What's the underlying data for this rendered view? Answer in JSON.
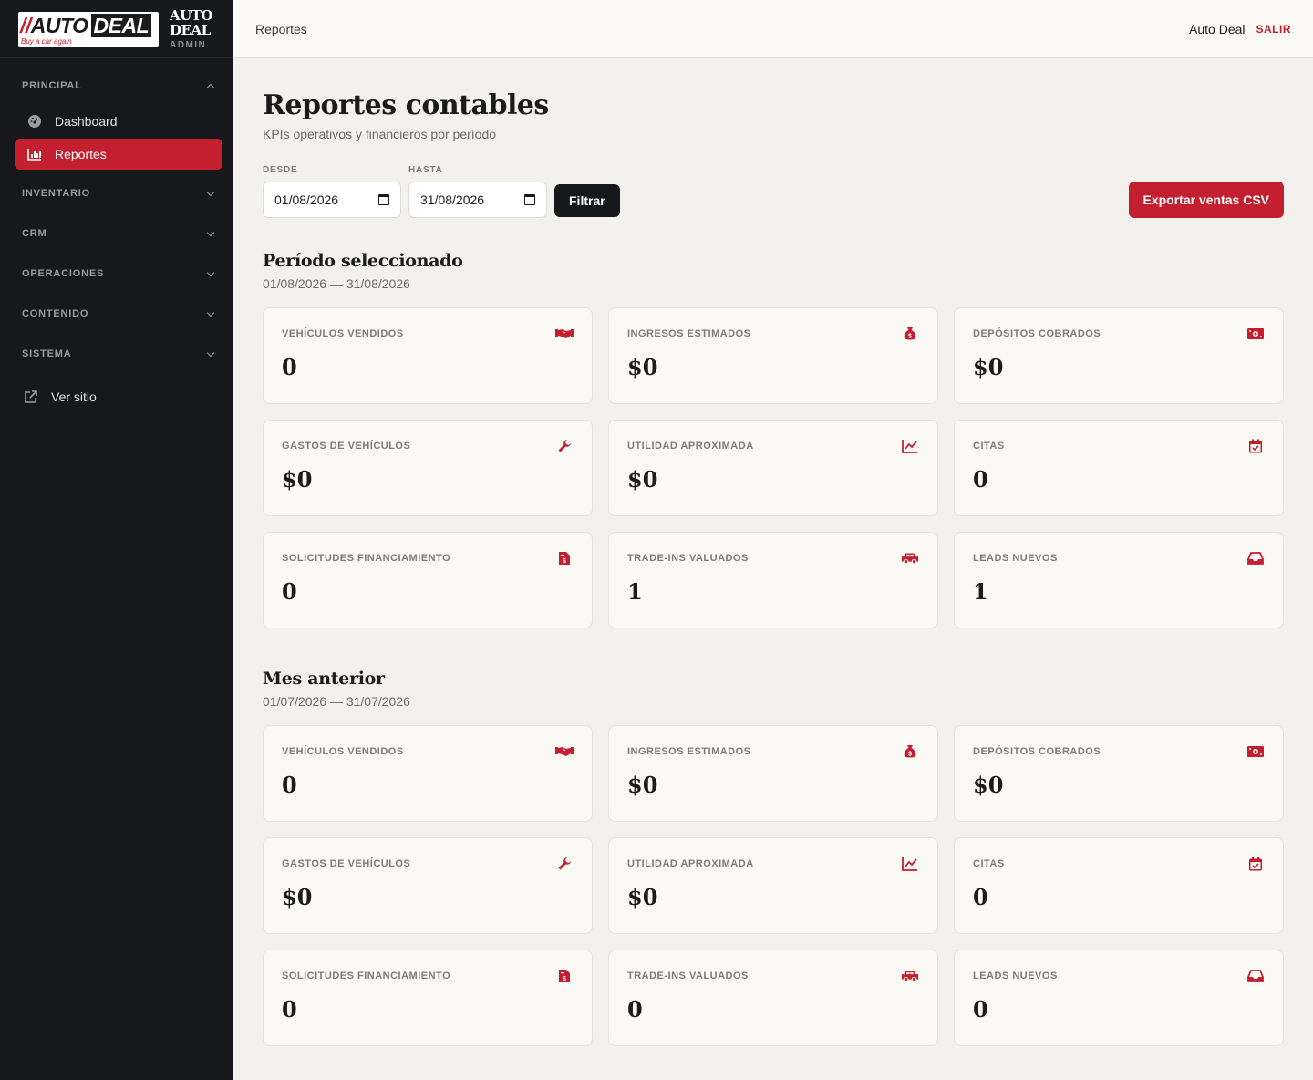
{
  "brand": {
    "logo_slash": "//",
    "logo_auto": "AUTO",
    "logo_deal": "DEAL",
    "logo_tagline": "Buy a car again",
    "name_line1": "AUTO",
    "name_line2": "DEAL",
    "subtitle": "ADMIN"
  },
  "sidebar": {
    "principal": "PRINCIPAL",
    "dashboard": "Dashboard",
    "reportes": "Reportes",
    "inventario": "INVENTARIO",
    "crm": "CRM",
    "operaciones": "OPERACIONES",
    "contenido": "CONTENIDO",
    "sistema": "SISTEMA",
    "ver_sitio": "Ver sitio"
  },
  "topbar": {
    "breadcrumb": "Reportes",
    "user": "Auto Deal",
    "logout": "SALIR"
  },
  "page": {
    "title": "Reportes contables",
    "subtitle": "KPIs operativos y financieros por período"
  },
  "filters": {
    "from_label": "DESDE",
    "from_value": "01/08/2026",
    "to_label": "HASTA",
    "to_value": "31/08/2026",
    "filter_button": "Filtrar",
    "export_button": "Exportar ventas CSV"
  },
  "accent_color": "#c41f2e",
  "sections": [
    {
      "title": "Período seleccionado",
      "range": "01/08/2026 — 31/08/2026",
      "cards": [
        {
          "label": "VEHÍCULOS VENDIDOS",
          "value": "0",
          "icon": "handshake-icon"
        },
        {
          "label": "INGRESOS ESTIMADOS",
          "value": "$0",
          "icon": "money-bag-icon"
        },
        {
          "label": "DEPÓSITOS COBRADOS",
          "value": "$0",
          "icon": "banknote-icon"
        },
        {
          "label": "GASTOS DE VEHÍCULOS",
          "value": "$0",
          "icon": "wrench-icon"
        },
        {
          "label": "UTILIDAD APROXIMADA",
          "value": "$0",
          "icon": "chart-line-icon"
        },
        {
          "label": "CITAS",
          "value": "0",
          "icon": "calendar-check-icon"
        },
        {
          "label": "SOLICITUDES FINANCIAMIENTO",
          "value": "0",
          "icon": "invoice-dollar-icon"
        },
        {
          "label": "TRADE-INS VALUADOS",
          "value": "1",
          "icon": "car-icon"
        },
        {
          "label": "LEADS NUEVOS",
          "value": "1",
          "icon": "inbox-icon"
        }
      ]
    },
    {
      "title": "Mes anterior",
      "range": "01/07/2026 — 31/07/2026",
      "cards": [
        {
          "label": "VEHÍCULOS VENDIDOS",
          "value": "0",
          "icon": "handshake-icon"
        },
        {
          "label": "INGRESOS ESTIMADOS",
          "value": "$0",
          "icon": "money-bag-icon"
        },
        {
          "label": "DEPÓSITOS COBRADOS",
          "value": "$0",
          "icon": "banknote-icon"
        },
        {
          "label": "GASTOS DE VEHÍCULOS",
          "value": "$0",
          "icon": "wrench-icon"
        },
        {
          "label": "UTILIDAD APROXIMADA",
          "value": "$0",
          "icon": "chart-line-icon"
        },
        {
          "label": "CITAS",
          "value": "0",
          "icon": "calendar-check-icon"
        },
        {
          "label": "SOLICITUDES FINANCIAMIENTO",
          "value": "0",
          "icon": "invoice-dollar-icon"
        },
        {
          "label": "TRADE-INS VALUADOS",
          "value": "0",
          "icon": "car-icon"
        },
        {
          "label": "LEADS NUEVOS",
          "value": "0",
          "icon": "inbox-icon"
        }
      ]
    }
  ]
}
